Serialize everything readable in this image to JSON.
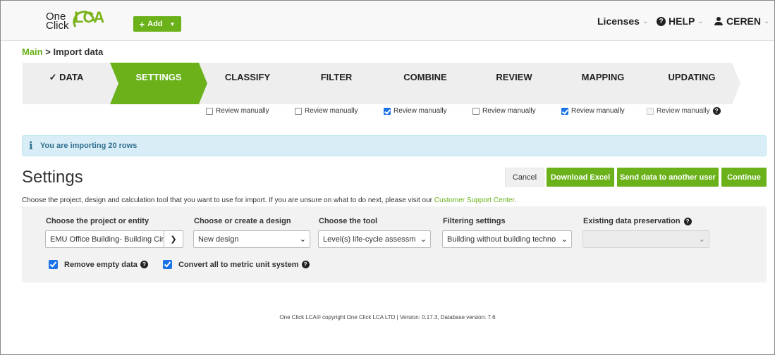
{
  "header": {
    "logo": {
      "line1": "One",
      "line2": "Click",
      "mark": "LCA"
    },
    "add_button": {
      "label": "Add",
      "icon": "plus-icon",
      "caret": "caret-down-icon"
    },
    "licenses": "Licenses",
    "help": "HELP",
    "help_icon": "question-circle-icon",
    "user": "CEREN",
    "user_icon": "user-icon",
    "dropdown_glyph": "⌄"
  },
  "breadcrumb": {
    "main": "Main",
    "separator": ">",
    "current": "Import data"
  },
  "steps": [
    {
      "label": "✓ DATA",
      "state": "done"
    },
    {
      "label": "SETTINGS",
      "state": "active"
    },
    {
      "label": "CLASSIFY",
      "state": "todo"
    },
    {
      "label": "FILTER",
      "state": "todo"
    },
    {
      "label": "COMBINE",
      "state": "todo"
    },
    {
      "label": "REVIEW",
      "state": "todo"
    },
    {
      "label": "MAPPING",
      "state": "todo"
    },
    {
      "label": "UPDATING",
      "state": "todo"
    }
  ],
  "review_checkboxes": [
    {
      "label": "Review manually",
      "checked": false
    },
    {
      "label": "Review manually",
      "checked": false
    },
    {
      "label": "Review manually",
      "checked": true
    },
    {
      "label": "Review manually",
      "checked": false
    },
    {
      "label": "Review manually",
      "checked": true
    },
    {
      "label": "Review manually",
      "checked": false,
      "disabled": true
    }
  ],
  "alert": {
    "icon": "info-icon",
    "text": "You are importing 20 rows"
  },
  "settings": {
    "title": "Settings",
    "cancel": "Cancel",
    "download": "Download Excel",
    "send": "Send data to another user",
    "continue": "Continue",
    "help_text": "Choose the project, design and calculation tool that you want to use for import. If you are unsure on what to do next, please visit our",
    "help_link": "Customer Support Center",
    "help_end": "."
  },
  "form": {
    "project_label": "Choose the project or entity",
    "project_value": "EMU Office Building- Building Cir",
    "design_label": "Choose or create a design",
    "design_value": "New design",
    "tool_label": "Choose the tool",
    "tool_value": "Level(s) life-cycle assessm",
    "filter_label": "Filtering settings",
    "filter_value": "Building without building techno",
    "preserve_label": "Existing data preservation",
    "preserve_value": "",
    "remove_empty": "Remove empty data",
    "metric": "Convert all to metric unit system"
  },
  "footer": "One Click LCA®   copyright One Click LCA LTD | Version: 0.17.3,   Database version: 7.6",
  "colors": {
    "brand_green": "#6ab11a",
    "step_gray": "#eeeeee",
    "checkbox_blue": "#1a73e8",
    "info_bg": "#d9edf7"
  }
}
